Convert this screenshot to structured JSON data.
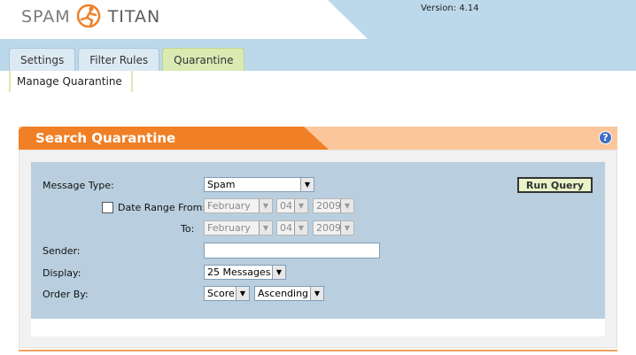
{
  "header": {
    "logo_left": "SPAM",
    "logo_right": "TITAN",
    "version": "Version: 4.14"
  },
  "tabs": [
    {
      "label": "Settings",
      "active": false
    },
    {
      "label": "Filter Rules",
      "active": false
    },
    {
      "label": "Quarantine",
      "active": true
    }
  ],
  "subnav": {
    "label": "Manage Quarantine"
  },
  "panel": {
    "title": "Search Quarantine",
    "help_icon": "?"
  },
  "form": {
    "message_type": {
      "label": "Message Type:",
      "value": "Spam"
    },
    "date_from": {
      "label": "Date Range From:",
      "checked": false,
      "month": "February",
      "day": "04",
      "year": "2009"
    },
    "date_to": {
      "label": "To:",
      "month": "February",
      "day": "04",
      "year": "2009"
    },
    "sender": {
      "label": "Sender:",
      "value": ""
    },
    "display": {
      "label": "Display:",
      "value": "25 Messages"
    },
    "order_by": {
      "label": "Order By:",
      "field": "Score",
      "direction": "Ascending"
    },
    "run_query": "Run Query"
  },
  "colors": {
    "accent_orange": "#f07f25",
    "header_blue": "#bcd9ec",
    "tab_active": "#d9ebb3",
    "form_bg": "#b9cfdf"
  }
}
